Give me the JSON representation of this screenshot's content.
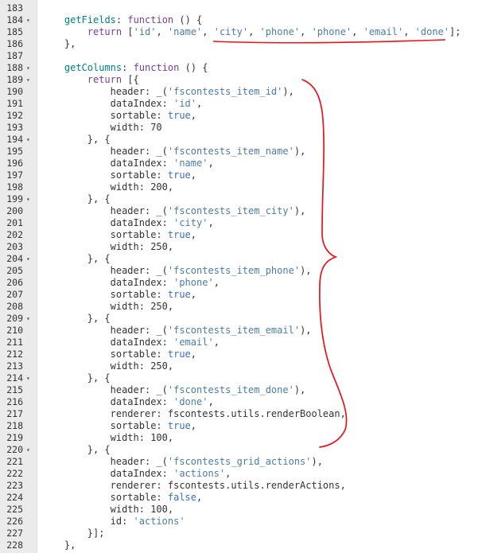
{
  "editor": {
    "lines": [
      {
        "n": "183",
        "fold": false,
        "indent": 0,
        "tokens": []
      },
      {
        "n": "184",
        "fold": true,
        "indent": 4,
        "tokens": [
          [
            "id",
            "getFields"
          ],
          [
            "pun",
            ": "
          ],
          [
            "kw",
            "function"
          ],
          [
            "pun",
            " () {"
          ]
        ]
      },
      {
        "n": "185",
        "fold": false,
        "indent": 8,
        "tokens": [
          [
            "kw",
            "return"
          ],
          [
            "pun",
            " ["
          ],
          [
            "str",
            "'id'"
          ],
          [
            "pun",
            ", "
          ],
          [
            "str",
            "'name'"
          ],
          [
            "pun",
            ", "
          ],
          [
            "str",
            "'city'"
          ],
          [
            "pun",
            ", "
          ],
          [
            "str",
            "'phone'"
          ],
          [
            "pun",
            ", "
          ],
          [
            "str",
            "'phone'"
          ],
          [
            "pun",
            ", "
          ],
          [
            "str",
            "'email'"
          ],
          [
            "pun",
            ", "
          ],
          [
            "str",
            "'done'"
          ],
          [
            "pun",
            "];"
          ]
        ]
      },
      {
        "n": "186",
        "fold": false,
        "indent": 4,
        "tokens": [
          [
            "pun",
            "},"
          ]
        ]
      },
      {
        "n": "187",
        "fold": false,
        "indent": 0,
        "tokens": []
      },
      {
        "n": "188",
        "fold": true,
        "indent": 4,
        "tokens": [
          [
            "id",
            "getColumns"
          ],
          [
            "pun",
            ": "
          ],
          [
            "kw",
            "function"
          ],
          [
            "pun",
            " () {"
          ]
        ]
      },
      {
        "n": "189",
        "fold": true,
        "indent": 8,
        "tokens": [
          [
            "kw",
            "return"
          ],
          [
            "pun",
            " [{"
          ]
        ]
      },
      {
        "n": "190",
        "fold": false,
        "indent": 12,
        "tokens": [
          [
            "key",
            "header"
          ],
          [
            "pun",
            ": _("
          ],
          [
            "str",
            "'fscontests_item_id'"
          ],
          [
            "pun",
            "),"
          ]
        ]
      },
      {
        "n": "191",
        "fold": false,
        "indent": 12,
        "tokens": [
          [
            "key",
            "dataIndex"
          ],
          [
            "pun",
            ": "
          ],
          [
            "str",
            "'id'"
          ],
          [
            "pun",
            ","
          ]
        ]
      },
      {
        "n": "192",
        "fold": false,
        "indent": 12,
        "tokens": [
          [
            "key",
            "sortable"
          ],
          [
            "pun",
            ": "
          ],
          [
            "bool",
            "true"
          ],
          [
            "pun",
            ","
          ]
        ]
      },
      {
        "n": "193",
        "fold": false,
        "indent": 12,
        "tokens": [
          [
            "key",
            "width"
          ],
          [
            "pun",
            ": "
          ],
          [
            "num",
            "70"
          ]
        ]
      },
      {
        "n": "194",
        "fold": true,
        "indent": 8,
        "tokens": [
          [
            "pun",
            "}, {"
          ]
        ]
      },
      {
        "n": "195",
        "fold": false,
        "indent": 12,
        "tokens": [
          [
            "key",
            "header"
          ],
          [
            "pun",
            ": _("
          ],
          [
            "str",
            "'fscontests_item_name'"
          ],
          [
            "pun",
            "),"
          ]
        ]
      },
      {
        "n": "196",
        "fold": false,
        "indent": 12,
        "tokens": [
          [
            "key",
            "dataIndex"
          ],
          [
            "pun",
            ": "
          ],
          [
            "str",
            "'name'"
          ],
          [
            "pun",
            ","
          ]
        ]
      },
      {
        "n": "197",
        "fold": false,
        "indent": 12,
        "tokens": [
          [
            "key",
            "sortable"
          ],
          [
            "pun",
            ": "
          ],
          [
            "bool",
            "true"
          ],
          [
            "pun",
            ","
          ]
        ]
      },
      {
        "n": "198",
        "fold": false,
        "indent": 12,
        "tokens": [
          [
            "key",
            "width"
          ],
          [
            "pun",
            ": "
          ],
          [
            "num",
            "200"
          ],
          [
            "pun",
            ","
          ]
        ]
      },
      {
        "n": "199",
        "fold": true,
        "indent": 8,
        "tokens": [
          [
            "pun",
            "}, {"
          ]
        ]
      },
      {
        "n": "200",
        "fold": false,
        "indent": 12,
        "tokens": [
          [
            "key",
            "header"
          ],
          [
            "pun",
            ": _("
          ],
          [
            "str",
            "'fscontests_item_city'"
          ],
          [
            "pun",
            "),"
          ]
        ]
      },
      {
        "n": "201",
        "fold": false,
        "indent": 12,
        "tokens": [
          [
            "key",
            "dataIndex"
          ],
          [
            "pun",
            ": "
          ],
          [
            "str",
            "'city'"
          ],
          [
            "pun",
            ","
          ]
        ]
      },
      {
        "n": "202",
        "fold": false,
        "indent": 12,
        "tokens": [
          [
            "key",
            "sortable"
          ],
          [
            "pun",
            ": "
          ],
          [
            "bool",
            "true"
          ],
          [
            "pun",
            ","
          ]
        ]
      },
      {
        "n": "203",
        "fold": false,
        "indent": 12,
        "tokens": [
          [
            "key",
            "width"
          ],
          [
            "pun",
            ": "
          ],
          [
            "num",
            "250"
          ],
          [
            "pun",
            ","
          ]
        ]
      },
      {
        "n": "204",
        "fold": true,
        "indent": 8,
        "tokens": [
          [
            "pun",
            "}, {"
          ]
        ]
      },
      {
        "n": "205",
        "fold": false,
        "indent": 12,
        "tokens": [
          [
            "key",
            "header"
          ],
          [
            "pun",
            ": _("
          ],
          [
            "str",
            "'fscontests_item_phone'"
          ],
          [
            "pun",
            "),"
          ]
        ]
      },
      {
        "n": "206",
        "fold": false,
        "indent": 12,
        "tokens": [
          [
            "key",
            "dataIndex"
          ],
          [
            "pun",
            ": "
          ],
          [
            "str",
            "'phone'"
          ],
          [
            "pun",
            ","
          ]
        ]
      },
      {
        "n": "207",
        "fold": false,
        "indent": 12,
        "tokens": [
          [
            "key",
            "sortable"
          ],
          [
            "pun",
            ": "
          ],
          [
            "bool",
            "true"
          ],
          [
            "pun",
            ","
          ]
        ]
      },
      {
        "n": "208",
        "fold": false,
        "indent": 12,
        "tokens": [
          [
            "key",
            "width"
          ],
          [
            "pun",
            ": "
          ],
          [
            "num",
            "250"
          ],
          [
            "pun",
            ","
          ]
        ]
      },
      {
        "n": "209",
        "fold": true,
        "indent": 8,
        "tokens": [
          [
            "pun",
            "}, {"
          ]
        ]
      },
      {
        "n": "210",
        "fold": false,
        "indent": 12,
        "tokens": [
          [
            "key",
            "header"
          ],
          [
            "pun",
            ": _("
          ],
          [
            "str",
            "'fscontests_item_email'"
          ],
          [
            "pun",
            "),"
          ]
        ]
      },
      {
        "n": "211",
        "fold": false,
        "indent": 12,
        "tokens": [
          [
            "key",
            "dataIndex"
          ],
          [
            "pun",
            ": "
          ],
          [
            "str",
            "'email'"
          ],
          [
            "pun",
            ","
          ]
        ]
      },
      {
        "n": "212",
        "fold": false,
        "indent": 12,
        "tokens": [
          [
            "key",
            "sortable"
          ],
          [
            "pun",
            ": "
          ],
          [
            "bool",
            "true"
          ],
          [
            "pun",
            ","
          ]
        ]
      },
      {
        "n": "213",
        "fold": false,
        "indent": 12,
        "tokens": [
          [
            "key",
            "width"
          ],
          [
            "pun",
            ": "
          ],
          [
            "num",
            "250"
          ],
          [
            "pun",
            ","
          ]
        ]
      },
      {
        "n": "214",
        "fold": true,
        "indent": 8,
        "tokens": [
          [
            "pun",
            "}, {"
          ]
        ]
      },
      {
        "n": "215",
        "fold": false,
        "indent": 12,
        "tokens": [
          [
            "key",
            "header"
          ],
          [
            "pun",
            ": _("
          ],
          [
            "str",
            "'fscontests_item_done'"
          ],
          [
            "pun",
            "),"
          ]
        ]
      },
      {
        "n": "216",
        "fold": false,
        "indent": 12,
        "tokens": [
          [
            "key",
            "dataIndex"
          ],
          [
            "pun",
            ": "
          ],
          [
            "str",
            "'done'"
          ],
          [
            "pun",
            ","
          ]
        ]
      },
      {
        "n": "217",
        "fold": false,
        "indent": 12,
        "tokens": [
          [
            "key",
            "renderer"
          ],
          [
            "pun",
            ": fscontests.utils.renderBoolean,"
          ]
        ]
      },
      {
        "n": "218",
        "fold": false,
        "indent": 12,
        "tokens": [
          [
            "key",
            "sortable"
          ],
          [
            "pun",
            ": "
          ],
          [
            "bool",
            "true"
          ],
          [
            "pun",
            ","
          ]
        ]
      },
      {
        "n": "219",
        "fold": false,
        "indent": 12,
        "tokens": [
          [
            "key",
            "width"
          ],
          [
            "pun",
            ": "
          ],
          [
            "num",
            "100"
          ],
          [
            "pun",
            ","
          ]
        ]
      },
      {
        "n": "220",
        "fold": true,
        "indent": 8,
        "tokens": [
          [
            "pun",
            "}, {"
          ]
        ]
      },
      {
        "n": "221",
        "fold": false,
        "indent": 12,
        "tokens": [
          [
            "key",
            "header"
          ],
          [
            "pun",
            ": _("
          ],
          [
            "str",
            "'fscontests_grid_actions'"
          ],
          [
            "pun",
            "),"
          ]
        ]
      },
      {
        "n": "222",
        "fold": false,
        "indent": 12,
        "tokens": [
          [
            "key",
            "dataIndex"
          ],
          [
            "pun",
            ": "
          ],
          [
            "str",
            "'actions'"
          ],
          [
            "pun",
            ","
          ]
        ]
      },
      {
        "n": "223",
        "fold": false,
        "indent": 12,
        "tokens": [
          [
            "key",
            "renderer"
          ],
          [
            "pun",
            ": fscontests.utils.renderActions,"
          ]
        ]
      },
      {
        "n": "224",
        "fold": false,
        "indent": 12,
        "tokens": [
          [
            "key",
            "sortable"
          ],
          [
            "pun",
            ": "
          ],
          [
            "bool",
            "false"
          ],
          [
            "pun",
            ","
          ]
        ]
      },
      {
        "n": "225",
        "fold": false,
        "indent": 12,
        "tokens": [
          [
            "key",
            "width"
          ],
          [
            "pun",
            ": "
          ],
          [
            "num",
            "100"
          ],
          [
            "pun",
            ","
          ]
        ]
      },
      {
        "n": "226",
        "fold": false,
        "indent": 12,
        "tokens": [
          [
            "key",
            "id"
          ],
          [
            "pun",
            ": "
          ],
          [
            "str",
            "'actions'"
          ]
        ]
      },
      {
        "n": "227",
        "fold": false,
        "indent": 8,
        "tokens": [
          [
            "pun",
            "}];"
          ]
        ]
      },
      {
        "n": "228",
        "fold": false,
        "indent": 4,
        "tokens": [
          [
            "pun",
            "},"
          ]
        ]
      }
    ]
  },
  "colors": {
    "identifier": "#008080",
    "keyword": "#7a3e9d",
    "string": "#4c7ca8",
    "boolean": "#3b6fb6",
    "annotation": "#e8141c",
    "gutter": "#ebebeb"
  },
  "icons": {
    "fold": "fold-arrow-icon"
  }
}
